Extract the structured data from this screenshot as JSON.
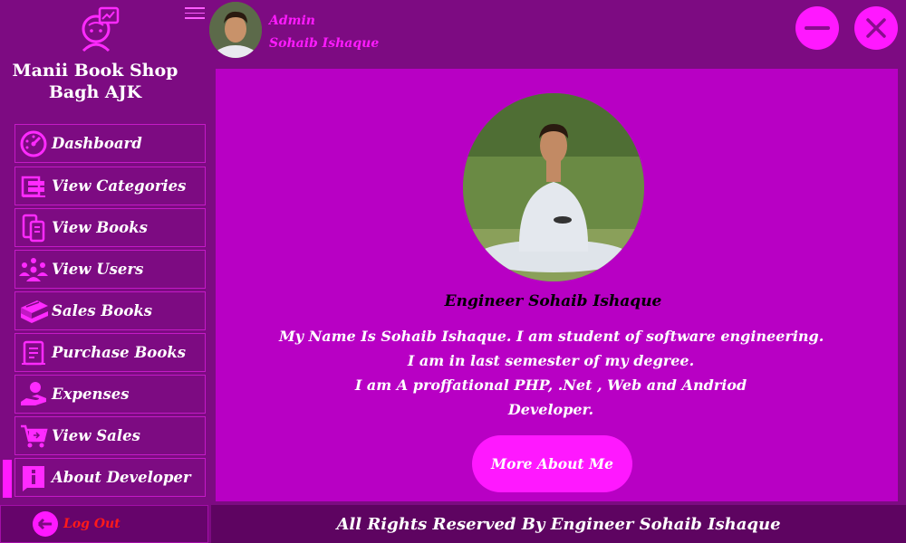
{
  "sidebar": {
    "shop_title_line1": "Manii Book Shop",
    "shop_title_line2": "Bagh AJK",
    "items": [
      {
        "label": "Dashboard",
        "icon": "dashboard-gauge-icon"
      },
      {
        "label": "View Categories",
        "icon": "categories-icon"
      },
      {
        "label": "View Books",
        "icon": "books-device-icon"
      },
      {
        "label": "View Users",
        "icon": "users-icon"
      },
      {
        "label": "Sales Books",
        "icon": "book-stack-icon"
      },
      {
        "label": "Purchase Books",
        "icon": "receipt-icon"
      },
      {
        "label": "Expenses",
        "icon": "hand-money-icon"
      },
      {
        "label": "View Sales",
        "icon": "cart-icon"
      },
      {
        "label": "About Developer",
        "icon": "info-icon"
      }
    ],
    "active_item": "About Developer",
    "logout_label": "Log Out"
  },
  "header": {
    "user_role": "Admin",
    "user_name": "Sohaib Ishaque"
  },
  "main": {
    "developer_title": "Engineer Sohaib Ishaque",
    "bio_lines": [
      "My Name Is Sohaib Ishaque. I am student of software engineering.",
      "I am in last semester of my degree.",
      "I am A proffational PHP, .Net , Web and Andriod",
      "Developer."
    ],
    "more_button": "More About Me"
  },
  "footer": {
    "text": "All Rights Reserved By Engineer Sohaib Ishaque"
  },
  "colors": {
    "background": "#7d0b82",
    "main_panel": "#b800c4",
    "accent": "#ff18ff",
    "footer": "#5e0461",
    "logout_text": "#ff1a1a"
  }
}
